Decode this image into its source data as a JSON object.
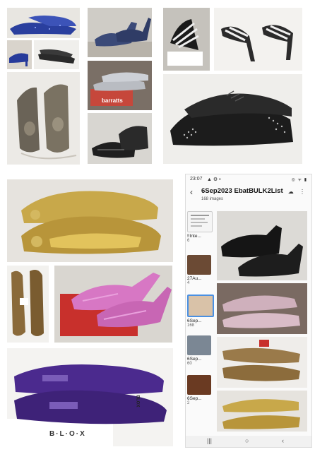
{
  "photos": {
    "blue_glitter": "blue glitter shoes",
    "barratts_label": "barratts",
    "blox_label": "B·L·O·X",
    "blox_brand_small": "BLOX"
  },
  "phone": {
    "time": "23:07",
    "status_icons": "▲ ⚙ •",
    "system_icons": "◎ ᯤ ▮",
    "back": "‹",
    "album_title": "6Sep2023  EbatBULK2List",
    "album_count": "168 images",
    "toolbar_icons": "☁ ⋮",
    "side_items": [
      {
        "label": "!!Inte...",
        "count": "6"
      },
      {
        "label": "27Au...",
        "count": "4"
      },
      {
        "label": "6Sep...",
        "count": "168"
      },
      {
        "label": "6Sep...",
        "count": "60"
      },
      {
        "label": "6Sep...",
        "count": "2"
      }
    ],
    "nav": {
      "recent": "|||",
      "home": "○",
      "back": "‹"
    }
  },
  "colors": {
    "blue_glitter": "#2a3f9e",
    "silver": "#b9bcc2",
    "gold": "#c8a84a",
    "pink": "#d777c4",
    "purple": "#4b2a8e",
    "black": "#1c1c1c",
    "pewter": "#6a6357"
  }
}
